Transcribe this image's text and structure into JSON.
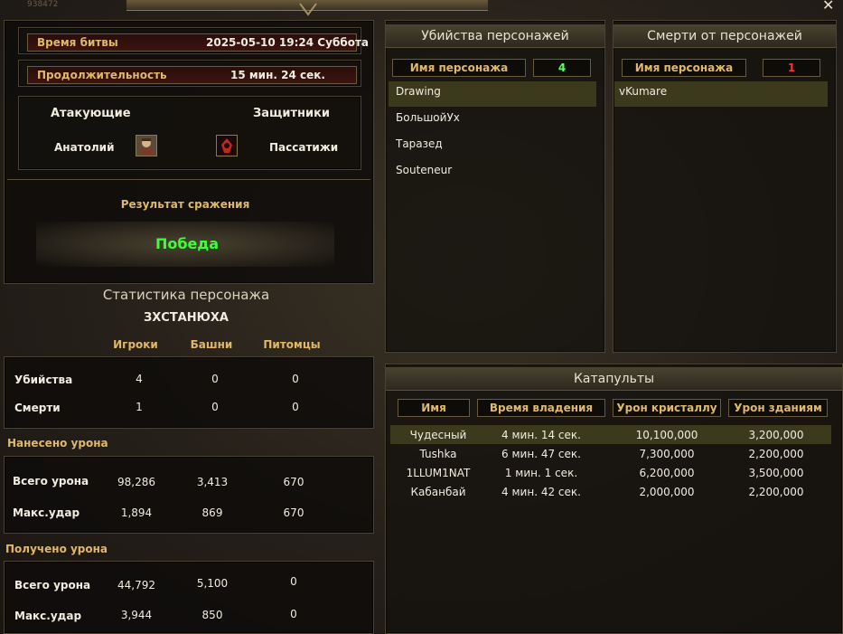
{
  "battle": {
    "time_label": "Время битвы",
    "time_value": "2025-05-10 19:24 Суббота",
    "duration_label": "Продолжительность",
    "duration_value": "15 мин. 24 сек.",
    "attackers_label": "Атакующие",
    "defenders_label": "Защитники",
    "attacker_name": "Анатолий",
    "defender_name": "Пассатижи",
    "result_label": "Результат сражения",
    "result_value": "Победа"
  },
  "stats": {
    "title": "Статистика персонажа",
    "character": "ЗХСТАНЮХА",
    "columns": [
      "Игроки",
      "Башни",
      "Питомцы"
    ],
    "rows": [
      {
        "label": "Убийства",
        "values": [
          "4",
          "0",
          "0"
        ]
      },
      {
        "label": "Смерти",
        "values": [
          "1",
          "0",
          "0"
        ]
      }
    ],
    "dealt_label": "Нанесено урона",
    "dealt_rows": [
      {
        "label": "Всего урона",
        "values": [
          "98,286",
          "3,413",
          "670"
        ]
      },
      {
        "label": "Макс.удар",
        "values": [
          "1,894",
          "869",
          "670"
        ]
      }
    ],
    "received_label": "Получено урона",
    "received_rows": [
      {
        "label": "Всего урона",
        "values": [
          "44,792",
          "5,100",
          "0"
        ]
      },
      {
        "label": "Макс.удар",
        "values": [
          "3,944",
          "850",
          "0"
        ]
      }
    ]
  },
  "kills": {
    "title": "Убийства персонажей",
    "name_header": "Имя персонажа",
    "count": "4",
    "count_color": "#5cff5c",
    "items": [
      "Drawing",
      "БольшойУх",
      "Таразед",
      "Souteneur"
    ]
  },
  "deaths": {
    "title": "Смерти от персонажей",
    "name_header": "Имя персонажа",
    "count": "1",
    "count_color": "#ff3030",
    "items": [
      "vKumare"
    ]
  },
  "catapults": {
    "title": "Катапульты",
    "headers": [
      "Имя",
      "Время владения",
      "Урон кристаллу",
      "Урон зданиям"
    ],
    "rows": [
      [
        "Чудесный",
        "4 мин. 14 сек.",
        "10,100,000",
        "3,200,000"
      ],
      [
        "Tushka",
        "6 мин. 47 сек.",
        "7,300,000",
        "2,200,000"
      ],
      [
        "1LLUM1NAT",
        "1 мин. 1 сек.",
        "6,200,000",
        "3,500,000"
      ],
      [
        "Кабанбай",
        "4 мин. 42 сек.",
        "2,000,000",
        "2,200,000"
      ]
    ]
  },
  "window": {
    "close_glyph": "✕",
    "corner_tag": "938472"
  },
  "colors": {
    "victory": "#3cff3c",
    "accent": "#e0b86a"
  },
  "icons": [
    "attacker-avatar-icon",
    "defender-emblem-icon",
    "close-icon",
    "ornament-icon"
  ]
}
